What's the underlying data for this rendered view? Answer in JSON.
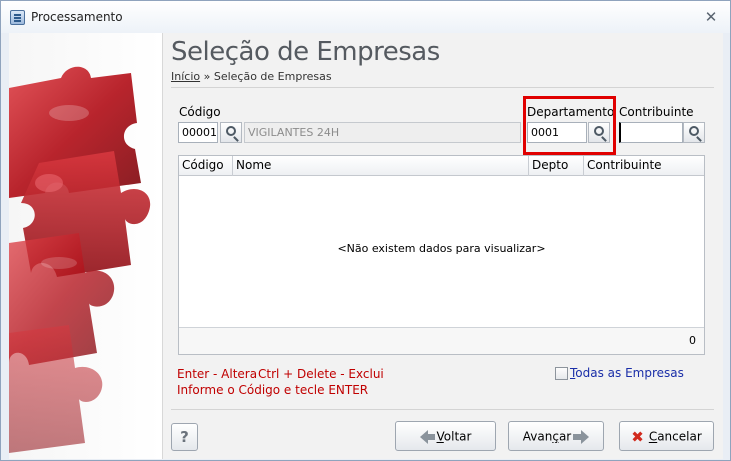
{
  "window": {
    "title": "Processamento",
    "close_glyph": "✕",
    "title_icon": "app-window-icon"
  },
  "header": {
    "title": "Seleção de Empresas",
    "breadcrumb_home": "Início",
    "breadcrumb_sep": " » ",
    "breadcrumb_current": "Seleção de Empresas"
  },
  "filters": {
    "codigo_label": "Código",
    "codigo_value": "00001",
    "empresa_name": "VIGILANTES 24H",
    "departamento_label": "Departamento",
    "departamento_value": "0001",
    "contribuinte_label": "Contribuinte",
    "contribuinte_value": ""
  },
  "grid": {
    "columns": [
      "Código",
      "Nome",
      "Depto",
      "Contribuinte"
    ],
    "empty_message": "<Não existem dados para visualizar>",
    "row_count": "0"
  },
  "hints": {
    "line1_a": "Enter - Altera",
    "line1_b": "Ctrl + Delete - Exclui",
    "line2": "Informe o Código e tecle ENTER"
  },
  "all_companies": {
    "label_first": "T",
    "label_rest": "odas as Empresas",
    "checked": false
  },
  "buttons": {
    "help": "?",
    "back_first": "V",
    "back_rest": "oltar",
    "next_a": "Avan",
    "next_u": "ç",
    "next_b": "ar",
    "cancel_first": "C",
    "cancel_rest": "ancelar"
  },
  "colors": {
    "highlight": "#e00000",
    "hint_text": "#c00000",
    "link_text": "#1a2ea8",
    "puzzle_red": "#b3121b"
  }
}
